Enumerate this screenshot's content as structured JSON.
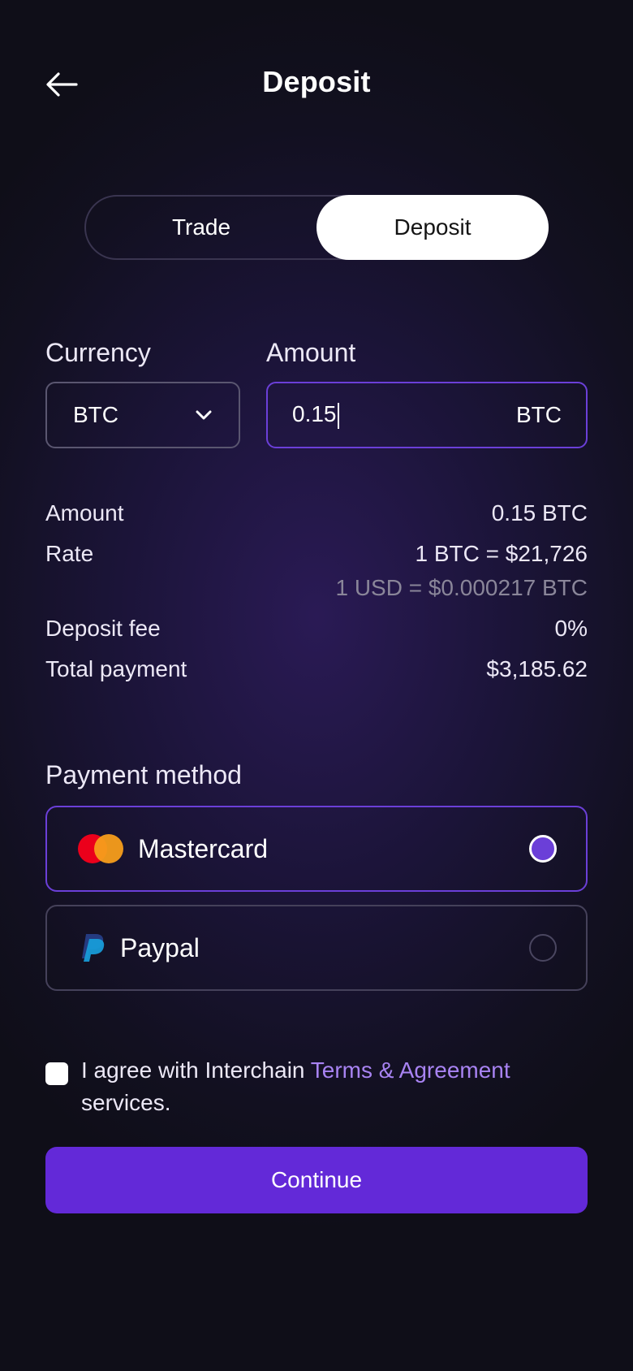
{
  "header": {
    "title": "Deposit",
    "back_icon": "arrow-left-icon"
  },
  "segmented": {
    "items": [
      {
        "label": "Trade",
        "selected": false
      },
      {
        "label": "Deposit",
        "selected": true
      }
    ]
  },
  "form": {
    "currency": {
      "label": "Currency",
      "value": "BTC",
      "icon": "chevron-down-icon"
    },
    "amount": {
      "label": "Amount",
      "value": "0.15",
      "unit": "BTC"
    }
  },
  "summary": {
    "amount": {
      "label": "Amount",
      "value": "0.15 BTC"
    },
    "rate": {
      "label": "Rate",
      "value": "1 BTC = $21,726",
      "sub_value": "1 USD = $0.000217 BTC"
    },
    "fee": {
      "label": "Deposit fee",
      "value": "0%"
    },
    "total": {
      "label": "Total payment",
      "value": "$3,185.62"
    }
  },
  "payment": {
    "label": "Payment method",
    "methods": [
      {
        "name": "Mastercard",
        "icon": "mastercard-icon",
        "selected": true
      },
      {
        "name": "Paypal",
        "icon": "paypal-icon",
        "selected": false
      }
    ]
  },
  "terms": {
    "prefix": "I agree with Interchain ",
    "link": "Terms & Agreement",
    "suffix": "services.",
    "checked": false
  },
  "actions": {
    "continue_label": "Continue"
  },
  "colors": {
    "accent": "#6329d8",
    "accent_border": "#6b3fd8",
    "link": "#a883f2",
    "background": "#1b1438"
  }
}
